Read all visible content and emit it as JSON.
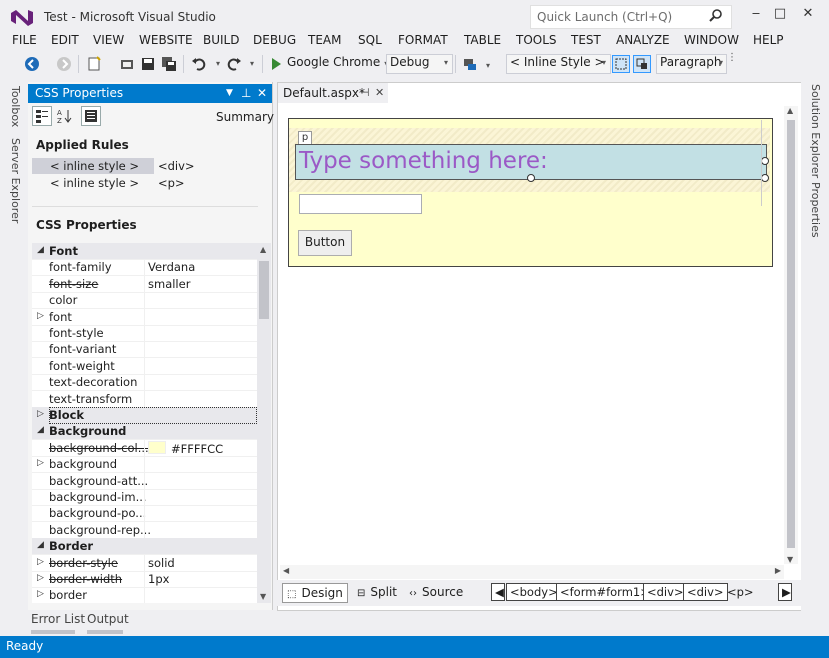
{
  "window": {
    "title": "Test - Microsoft Visual Studio"
  },
  "quick_launch": {
    "placeholder": "Quick Launch (Ctrl+Q)"
  },
  "window_controls": {
    "minimize": "‒",
    "maximize": "□",
    "close": "✕"
  },
  "menu": [
    "FILE",
    "EDIT",
    "VIEW",
    "WEBSITE",
    "BUILD",
    "DEBUG",
    "TEAM",
    "SQL",
    "FORMAT",
    "TABLE",
    "TOOLS",
    "TEST",
    "ANALYZE",
    "WINDOW",
    "HELP"
  ],
  "toolbar": {
    "browser": "Google Chrome",
    "config": "Debug",
    "style_target": "< Inline Style >",
    "block_format": "Paragraph"
  },
  "left_tabs": [
    "Toolbox",
    "Server Explorer"
  ],
  "right_tabs": [
    "Solution Explorer",
    "Properties"
  ],
  "css_panel": {
    "title": "CSS Properties",
    "summary_label": "Summary",
    "applied_rules_title": "Applied Rules",
    "applied_rules": [
      {
        "rule": "< inline style >",
        "element": "<div>"
      },
      {
        "rule": "< inline style >",
        "element": "<p>"
      }
    ],
    "properties_title": "CSS Properties",
    "properties": [
      {
        "name": "Font",
        "value": "",
        "category": true,
        "expander": "◢"
      },
      {
        "name": "font-family",
        "value": "Verdana"
      },
      {
        "name": "font-size",
        "value": "smaller",
        "strike": true
      },
      {
        "name": "color",
        "value": ""
      },
      {
        "name": "font",
        "value": "",
        "expander": "▷"
      },
      {
        "name": "font-style",
        "value": ""
      },
      {
        "name": "font-variant",
        "value": ""
      },
      {
        "name": "font-weight",
        "value": ""
      },
      {
        "name": "text-decoration",
        "value": ""
      },
      {
        "name": "text-transform",
        "value": ""
      },
      {
        "name": "Block",
        "value": "",
        "category": true,
        "expander": "▷"
      },
      {
        "name": "Background",
        "value": "",
        "category": true,
        "expander": "◢"
      },
      {
        "name": "background-col...",
        "value": "#FFFFCC",
        "strike": true,
        "swatch": "#FFFFCC"
      },
      {
        "name": "background",
        "value": "",
        "expander": "▷"
      },
      {
        "name": "background-att...",
        "value": ""
      },
      {
        "name": "background-im...",
        "value": ""
      },
      {
        "name": "background-po...",
        "value": ""
      },
      {
        "name": "background-rep...",
        "value": ""
      },
      {
        "name": "Border",
        "value": "",
        "category": true,
        "expander": "◢"
      },
      {
        "name": "border-style",
        "value": "solid",
        "strike": true,
        "expander": "▷"
      },
      {
        "name": "border-width",
        "value": "1px",
        "strike": true,
        "expander": "▷"
      },
      {
        "name": "border",
        "value": "",
        "expander": "▷"
      }
    ]
  },
  "bottom_tabs": [
    "Error List",
    "Output"
  ],
  "document": {
    "tab_title": "Default.aspx*",
    "p_tag": "p",
    "heading_text": "Type something here:",
    "button_label": "Button"
  },
  "view_bar": {
    "design": "Design",
    "split": "Split",
    "source": "Source",
    "crumbs": [
      "<body>",
      "<form#form1>",
      "<div>",
      "<div>",
      "<p>"
    ]
  },
  "status": {
    "text": "Ready"
  },
  "colors": {
    "accent": "#007acc",
    "form_bg": "#FFFFCC",
    "p_bg": "#c2e0e4",
    "p_text": "#9b59c6"
  }
}
